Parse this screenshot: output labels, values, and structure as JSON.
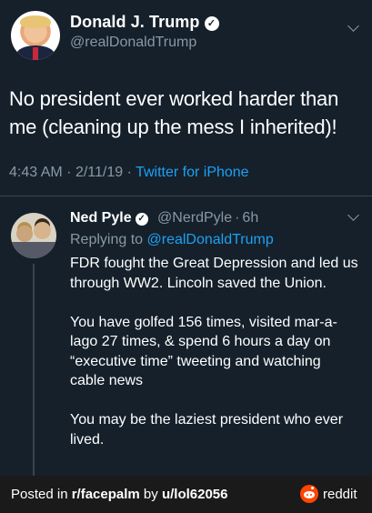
{
  "main_tweet": {
    "author_name": "Donald J. Trump",
    "author_handle": "@realDonaldTrump",
    "text": "No president ever worked harder than me (cleaning up the mess I inherited)!",
    "time": "4:43 AM",
    "date": "2/11/19",
    "separator": "·",
    "source": "Twitter for iPhone"
  },
  "reply": {
    "author_name": "Ned Pyle",
    "author_handle": "@NerdPyle",
    "separator": "·",
    "age": "6h",
    "replying_to_label": "Replying to",
    "replying_to_handle": "@realDonaldTrump",
    "paragraphs": [
      "FDR fought the Great Depression  and led us through WW2. Lincoln saved the Union.",
      "You have golfed 156 times, visited mar-a-lago 27 times, & spend 6 hours a day on “executive time” tweeting and watching cable news",
      "You may be the laziest president who ever lived."
    ]
  },
  "footer": {
    "posted_in": "Posted in ",
    "subreddit": "r/facepalm",
    "by": " by ",
    "user": "u/lol62056",
    "brand": "reddit"
  },
  "icons": {
    "verified": "verified-badge-icon",
    "more": "chevron-down-icon",
    "brand_logo": "reddit-logo-icon"
  },
  "colors": {
    "background": "#15202b",
    "secondary_text": "#8899a6",
    "link": "#1da1f2",
    "footer_background": "#1a1a1b",
    "reddit_orange": "#ff4500"
  }
}
